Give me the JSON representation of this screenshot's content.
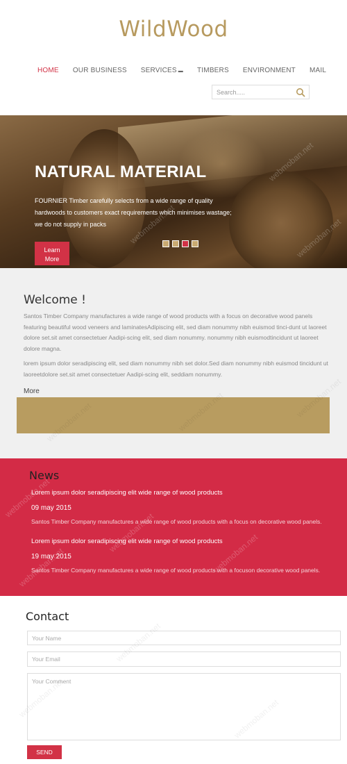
{
  "brand": {
    "name": "WildWood",
    "accent": "#d23246",
    "gold": "#b89c60"
  },
  "nav": {
    "items": [
      {
        "label": "HOME",
        "active": true
      },
      {
        "label": "OUR BUSINESS"
      },
      {
        "label": "SERVICES",
        "has_dropdown": true
      },
      {
        "label": "TIMBERS"
      },
      {
        "label": "ENVIRONMENT"
      },
      {
        "label": "MAIL"
      }
    ],
    "caret": "▬"
  },
  "search": {
    "placeholder": "Search.....",
    "icon": "search-icon"
  },
  "hero": {
    "title": "NATURAL MATERIAL",
    "text": "FOURNIER Timber carefully selects from a wide range of quality hardwoods to customers exact requirements which minimises wastage; we do not supply in packs",
    "button_line1": "Learn",
    "button_line2": "More",
    "slides": 4,
    "active_slide": 3
  },
  "welcome": {
    "title": "Welcome !",
    "p1": "Santos Timber Company manufactures a wide range of wood products with a focus on decorative wood panels featuring beautiful wood veneers and laminatesAdipiscing elit, sed diam nonummy nibh euismod tinci-dunt ut laoreet dolore set.sit amet consectetuer Aadipi-scing elit, sed diam nonummy. nonummy nibh euismodtincidunt ut laoreet dolore magna.",
    "p2": "lorem ipsum dolor seradipiscing elit, sed diam nonummy nibh set dolor.Sed diam nonummy nibh euismod tincidunt ut laoreetdolore set.sit amet consectetuer Aadipi-scing elit, seddiam nonummy.",
    "more": "More"
  },
  "news": {
    "title": "News",
    "items": [
      {
        "title": "Lorem ipsum dolor seradipiscing elit wide range of wood products",
        "date": "09 may 2015",
        "text": "Santos Timber Company manufactures a wide range of wood products with a focus on decorative wood panels."
      },
      {
        "title": "Lorem ipsum dolor seradipiscing elit wide range of wood products",
        "date": "19 may 2015",
        "text": "Santos Timber Company manufactures a wide range of wood products with a focuson decorative wood panels."
      }
    ]
  },
  "contact": {
    "title": "Contact",
    "name_placeholder": "Your Name",
    "email_placeholder": "Your Email",
    "comment_placeholder": "Your Comment",
    "send": "SEND"
  },
  "watermark": "webmoban.net"
}
